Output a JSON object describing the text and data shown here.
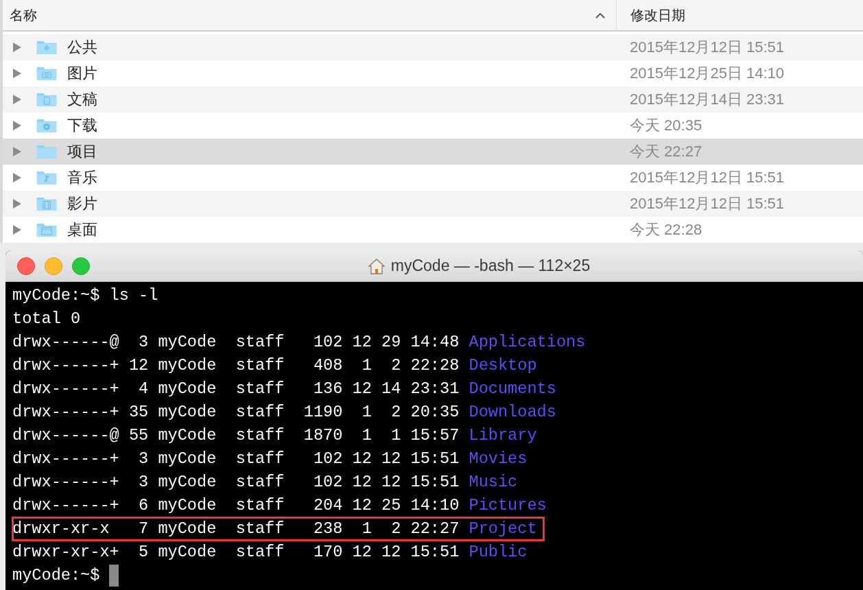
{
  "finder": {
    "columns": [
      {
        "label": "名称",
        "sorted": true
      },
      {
        "label": "修改日期"
      }
    ],
    "rows": [
      {
        "name": "公共",
        "kind": "public",
        "modified": "2015年12月12日 15:51",
        "selected": false
      },
      {
        "name": "图片",
        "kind": "camera",
        "modified": "2015年12月25日 14:10",
        "selected": false
      },
      {
        "name": "文稿",
        "kind": "document",
        "modified": "2015年12月14日 23:31",
        "selected": false
      },
      {
        "name": "下载",
        "kind": "download",
        "modified": "今天 20:35",
        "selected": false
      },
      {
        "name": "项目",
        "kind": "plain",
        "modified": "今天 22:27",
        "selected": true
      },
      {
        "name": "音乐",
        "kind": "music",
        "modified": "2015年12月12日 15:51",
        "selected": false
      },
      {
        "name": "影片",
        "kind": "film",
        "modified": "2015年12月12日 15:51",
        "selected": false
      },
      {
        "name": "桌面",
        "kind": "desktop",
        "modified": "今天 22:28",
        "selected": false
      }
    ]
  },
  "terminal": {
    "title": "myCode — -bash — 112×25",
    "command": "myCode:~$ ls -l",
    "total": "total 0",
    "entries": [
      {
        "attributes": "drwx------@  3 myCode  staff   102 12 29 14:48",
        "name": "Applications",
        "highlighted": false
      },
      {
        "attributes": "drwx------+ 12 myCode  staff   408  1  2 22:28",
        "name": "Desktop",
        "highlighted": false
      },
      {
        "attributes": "drwx------+  4 myCode  staff   136 12 14 23:31",
        "name": "Documents",
        "highlighted": false
      },
      {
        "attributes": "drwx------+ 35 myCode  staff  1190  1  2 20:35",
        "name": "Downloads",
        "highlighted": false
      },
      {
        "attributes": "drwx------@ 55 myCode  staff  1870  1  1 15:57",
        "name": "Library",
        "highlighted": false
      },
      {
        "attributes": "drwx------+  3 myCode  staff   102 12 12 15:51",
        "name": "Movies",
        "highlighted": false
      },
      {
        "attributes": "drwx------+  3 myCode  staff   102 12 12 15:51",
        "name": "Music",
        "highlighted": false
      },
      {
        "attributes": "drwx------+  6 myCode  staff   204 12 25 14:10",
        "name": "Pictures",
        "highlighted": false
      },
      {
        "attributes": "drwxr-xr-x   7 myCode  staff   238  1  2 22:27",
        "name": "Project",
        "highlighted": true
      },
      {
        "attributes": "drwxr-xr-x+  5 myCode  staff   170 12 12 15:51",
        "name": "Public",
        "highlighted": false
      }
    ],
    "prompt": "myCode:~$"
  }
}
